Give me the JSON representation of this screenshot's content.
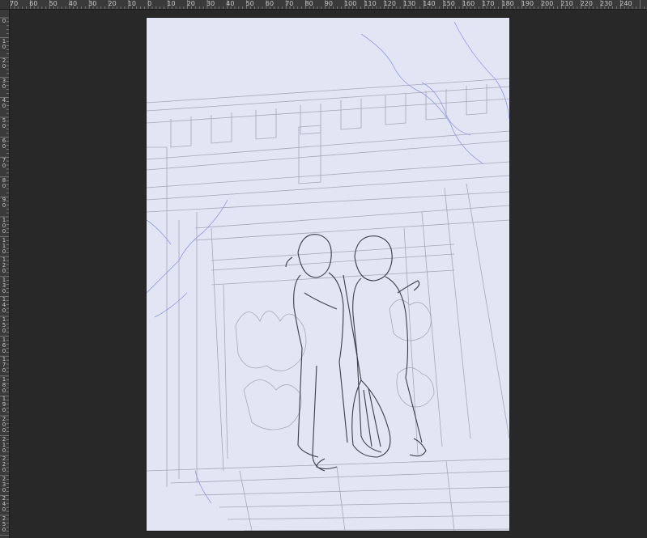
{
  "rulers": {
    "top_ticks": [
      "70",
      "60",
      "50",
      "40",
      "30",
      "20",
      "10",
      "0",
      "10",
      "20",
      "30",
      "40",
      "50",
      "60",
      "70",
      "80",
      "90",
      "100",
      "110",
      "120",
      "130",
      "140",
      "150",
      "160",
      "170",
      "180",
      "190",
      "200",
      "210",
      "220",
      "230",
      "240"
    ],
    "left_ticks": [
      "0",
      "10",
      "20",
      "30",
      "40",
      "50",
      "60",
      "70",
      "80",
      "90",
      "100",
      "110",
      "120",
      "130",
      "140",
      "150",
      "160",
      "170",
      "180",
      "190",
      "200",
      "210",
      "220",
      "230",
      "240",
      "250"
    ]
  },
  "canvas": {
    "background_color": "#e2e6f4",
    "line_color_gray": "#9aa0b4",
    "line_color_blue": "#8f9ad8",
    "line_color_dark": "#3a3a44"
  },
  "workspace": {
    "background_color": "#282828"
  },
  "icons": {
    "ruler_corner": "ruler-origin-icon"
  }
}
